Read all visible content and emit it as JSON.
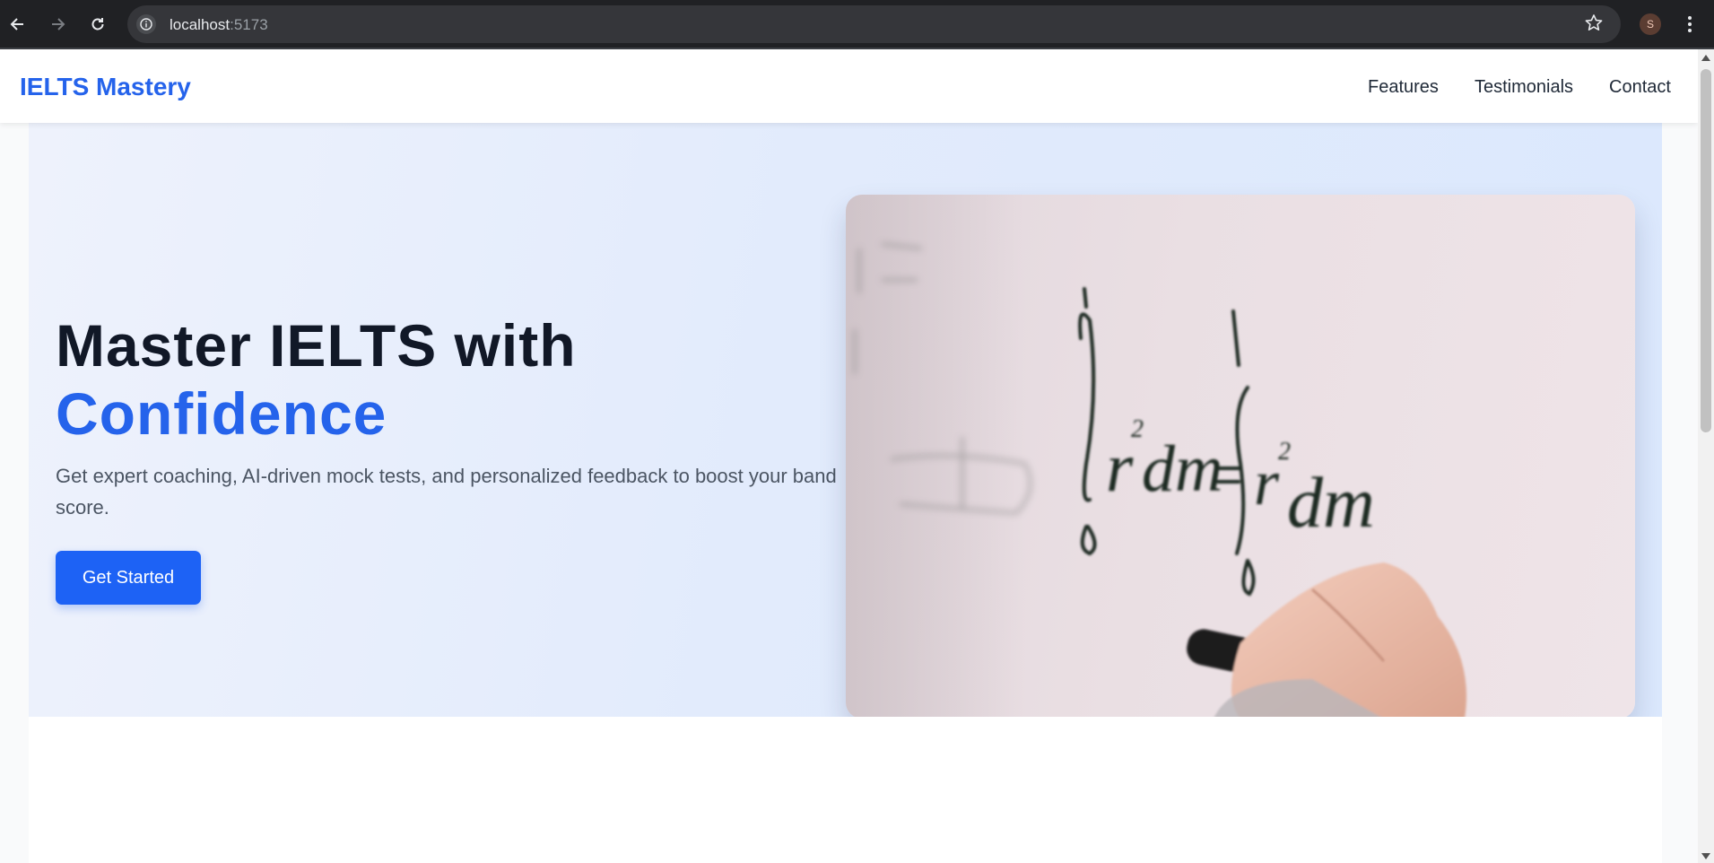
{
  "browser": {
    "url_host": "localhost",
    "url_port": ":5173",
    "profile_initial": "S"
  },
  "header": {
    "brand": "IELTS Mastery",
    "nav": [
      "Features",
      "Testimonials",
      "Contact"
    ]
  },
  "hero": {
    "title_line1": "Master IELTS with",
    "title_line2": "Confidence",
    "subtitle": "Get expert coaching, AI-driven mock tests, and personalized feedback to boost your band score.",
    "cta_label": "Get Started",
    "image": {
      "subject": "hand writing calculus equation on whiteboard",
      "accent_color": "#2563eb"
    }
  },
  "colors": {
    "brand": "#2563eb",
    "cta": "#1d62f5",
    "heading": "#111827"
  }
}
